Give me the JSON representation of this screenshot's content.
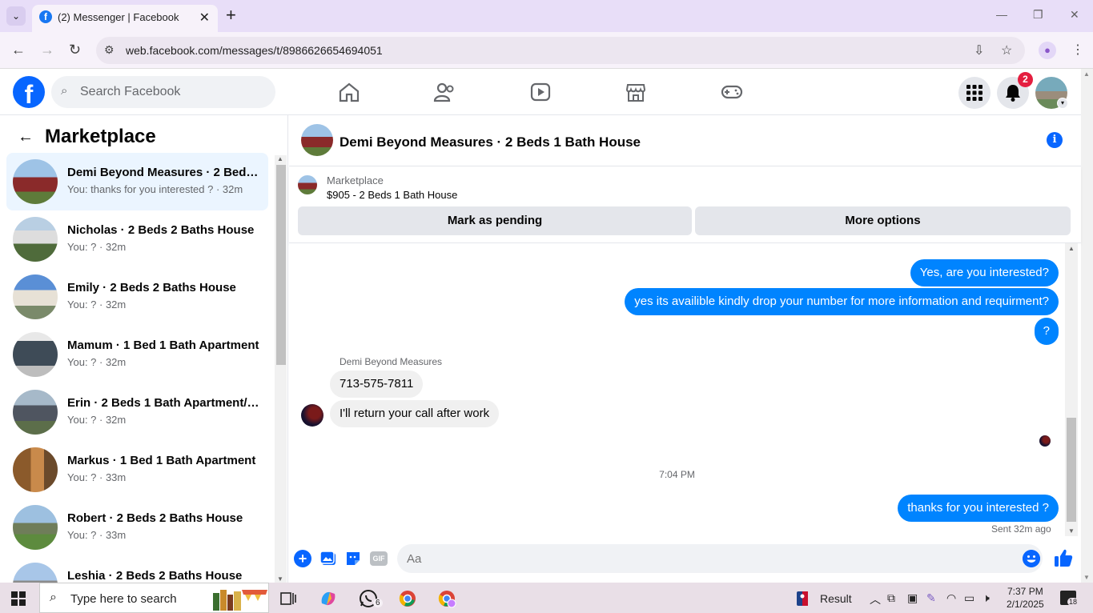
{
  "browser": {
    "tab_title": "(2) Messenger | Facebook",
    "url": "web.facebook.com/messages/t/8986626654694051"
  },
  "fb": {
    "search_placeholder": "Search Facebook",
    "notification_count": "2"
  },
  "sidebar": {
    "title": "Marketplace",
    "conversations": [
      {
        "name": "Demi Beyond Measures · 2 Beds 1 Bath House",
        "sub": "You: thanks for you interested ? · 32m"
      },
      {
        "name": "Nicholas · 2 Beds 2 Baths House",
        "sub": "You: ? · 32m"
      },
      {
        "name": "Emily · 2 Beds 2 Baths House",
        "sub": "You: ? · 32m"
      },
      {
        "name": "Mamum · 1 Bed 1 Bath Apartment",
        "sub": "You: ? · 32m"
      },
      {
        "name": "Erin · 2 Beds 1 Bath Apartment/Condo",
        "sub": "You: ? · 32m"
      },
      {
        "name": "Markus · 1 Bed 1 Bath Apartment",
        "sub": "You: ? · 33m"
      },
      {
        "name": "Robert · 2 Beds 2 Baths House",
        "sub": "You: ? · 33m"
      },
      {
        "name": "Leshia · 2 Beds 2 Baths House",
        "sub": ""
      }
    ]
  },
  "chat": {
    "title": "Demi Beyond Measures · 2 Beds 1 Bath House",
    "listing_label": "Marketplace",
    "listing_price": "$905 - 2 Beds 1 Bath House",
    "btn_pending": "Mark as pending",
    "btn_more": "More options",
    "messages": {
      "out1": "Yes, are you interested?",
      "out2": "yes its availible kindly drop your number for more information and requirment?",
      "out3": "?",
      "sender": "Demi Beyond Measures",
      "in1": "713-575-7811",
      "in2": "I'll return your call after work",
      "timestamp": "7:04 PM",
      "out4": "thanks for you interested ?",
      "sent_status": "Sent 32m ago"
    },
    "composer_placeholder": "Aa",
    "gif_label": "GIF"
  },
  "taskbar": {
    "search_placeholder": "Type here to search",
    "whatsapp_badge": "6",
    "widget_text": "Result",
    "time": "7:37 PM",
    "date": "2/1/2025",
    "notif_count": "18"
  }
}
